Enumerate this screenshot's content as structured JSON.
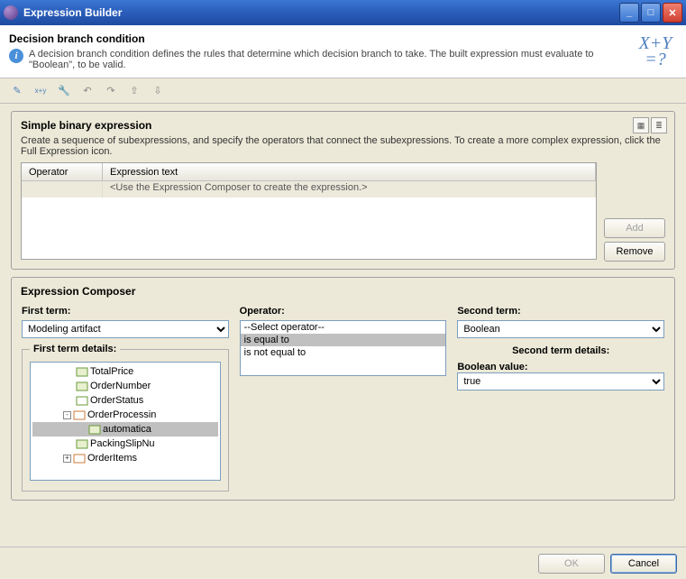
{
  "window": {
    "title": "Expression Builder"
  },
  "header": {
    "title": "Decision branch condition",
    "desc": "A decision branch condition defines the rules that determine which decision branch to take. The built expression must evaluate to \"Boolean\", to be valid."
  },
  "simple": {
    "title": "Simple binary expression",
    "desc": "Create a sequence of subexpressions, and specify the operators that connect the subexpressions. To create a more complex expression, click the Full Expression icon.",
    "col_operator": "Operator",
    "col_text": "Expression text",
    "placeholder": "<Use the Expression Composer to create the expression.>",
    "add": "Add",
    "remove": "Remove"
  },
  "composer": {
    "title": "Expression Composer",
    "first_label": "First term:",
    "first_value": "Modeling artifact",
    "first_details": "First term details:",
    "operator_label": "Operator:",
    "op0": "--Select operator--",
    "op1": "is equal to",
    "op2": "is not equal to",
    "second_label": "Second term:",
    "second_value": "Boolean",
    "second_details": "Second term details:",
    "bool_label": "Boolean value:",
    "bool_value": "true"
  },
  "tree": {
    "n0": "TotalPrice",
    "n1": "OrderNumber",
    "n2": "OrderStatus",
    "n3": "OrderProcessin",
    "n4": "automatica",
    "n5": "PackingSlipNu",
    "n6": "OrderItems"
  },
  "footer": {
    "ok": "OK",
    "cancel": "Cancel"
  }
}
